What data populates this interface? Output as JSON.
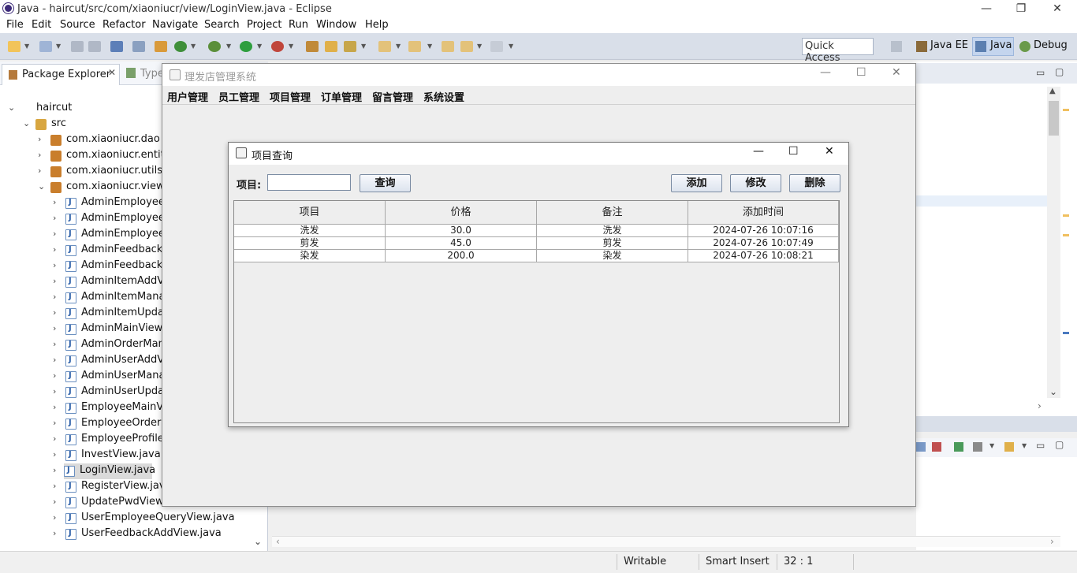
{
  "eclipse": {
    "title": "Java - haircut/src/com/xiaoniucr/view/LoginView.java - Eclipse",
    "menu": [
      "File",
      "Edit",
      "Source",
      "Refactor",
      "Navigate",
      "Search",
      "Project",
      "Run",
      "Window",
      "Help"
    ],
    "quick_access": "Quick Access",
    "perspectives": [
      "Java EE",
      "Java",
      "Debug"
    ],
    "window_controls": {
      "minimize": "—",
      "restore": "❐",
      "close": "✕"
    }
  },
  "package_explorer": {
    "tab_label": "Package Explorer",
    "tab2_label": "Type",
    "tree": [
      {
        "label": "haircut",
        "kind": "project",
        "depth": 0,
        "arrow": "⌄"
      },
      {
        "label": "src",
        "kind": "src",
        "depth": 1,
        "arrow": "⌄"
      },
      {
        "label": "com.xiaoniucr.dao",
        "kind": "pkg",
        "depth": 2,
        "arrow": "›"
      },
      {
        "label": "com.xiaoniucr.entity",
        "kind": "pkg",
        "depth": 2,
        "arrow": "›"
      },
      {
        "label": "com.xiaoniucr.utils",
        "kind": "pkg",
        "depth": 2,
        "arrow": "›"
      },
      {
        "label": "com.xiaoniucr.view",
        "kind": "pkg",
        "depth": 2,
        "arrow": "⌄"
      },
      {
        "label": "AdminEmployeeA",
        "kind": "java",
        "depth": 3,
        "arrow": "›"
      },
      {
        "label": "AdminEmployeeM",
        "kind": "java",
        "depth": 3,
        "arrow": "›"
      },
      {
        "label": "AdminEmployeeU",
        "kind": "java",
        "depth": 3,
        "arrow": "›"
      },
      {
        "label": "AdminFeedbackM",
        "kind": "java",
        "depth": 3,
        "arrow": "›"
      },
      {
        "label": "AdminFeedbackR",
        "kind": "java",
        "depth": 3,
        "arrow": "›"
      },
      {
        "label": "AdminItemAddVi",
        "kind": "java",
        "depth": 3,
        "arrow": "›"
      },
      {
        "label": "AdminItemManag",
        "kind": "java",
        "depth": 3,
        "arrow": "›"
      },
      {
        "label": "AdminItemUpdat",
        "kind": "java",
        "depth": 3,
        "arrow": "›"
      },
      {
        "label": "AdminMainView.j",
        "kind": "java",
        "depth": 3,
        "arrow": "›"
      },
      {
        "label": "AdminOrderMana",
        "kind": "java",
        "depth": 3,
        "arrow": "›"
      },
      {
        "label": "AdminUserAddVi",
        "kind": "java",
        "depth": 3,
        "arrow": "›"
      },
      {
        "label": "AdminUserManag",
        "kind": "java",
        "depth": 3,
        "arrow": "›"
      },
      {
        "label": "AdminUserUpdat",
        "kind": "java",
        "depth": 3,
        "arrow": "›"
      },
      {
        "label": "EmployeeMainVie",
        "kind": "java",
        "depth": 3,
        "arrow": "›"
      },
      {
        "label": "EmployeeOrderM",
        "kind": "java",
        "depth": 3,
        "arrow": "›"
      },
      {
        "label": "EmployeeProfileV",
        "kind": "java",
        "depth": 3,
        "arrow": "›"
      },
      {
        "label": "InvestView.java",
        "kind": "java",
        "depth": 3,
        "arrow": "›"
      },
      {
        "label": "LoginView.java",
        "kind": "java",
        "depth": 3,
        "arrow": "›",
        "selected": true
      },
      {
        "label": "RegisterView.java",
        "kind": "java",
        "depth": 3,
        "arrow": "›"
      },
      {
        "label": "UpdatePwdView.java",
        "kind": "java",
        "depth": 3,
        "arrow": "›"
      },
      {
        "label": "UserEmployeeQueryView.java",
        "kind": "java",
        "depth": 3,
        "arrow": "›"
      },
      {
        "label": "UserFeedbackAddView.java",
        "kind": "java",
        "depth": 3,
        "arrow": "›"
      }
    ]
  },
  "statusbar": {
    "mode": "Writable",
    "insert": "Smart Insert",
    "position": "32 : 1"
  },
  "app": {
    "title": "理发店管理系统",
    "menu": [
      "用户管理",
      "员工管理",
      "项目管理",
      "订单管理",
      "留言管理",
      "系统设置"
    ],
    "window_controls": {
      "minimize": "—",
      "maximize": "☐",
      "close": "✕"
    }
  },
  "dialog": {
    "title": "项目查询",
    "item_label": "项目:",
    "item_value": "",
    "query_button": "查询",
    "add_button": "添加",
    "edit_button": "修改",
    "delete_button": "删除",
    "window_controls": {
      "minimize": "—",
      "maximize": "☐",
      "close": "✕"
    },
    "table": {
      "columns": [
        "项目",
        "价格",
        "备注",
        "添加时间"
      ],
      "rows": [
        [
          "洗发",
          "30.0",
          "洗发",
          "2024-07-26 10:07:16"
        ],
        [
          "剪发",
          "45.0",
          "剪发",
          "2024-07-26 10:07:49"
        ],
        [
          "染发",
          "200.0",
          "染发",
          "2024-07-26 10:08:21"
        ]
      ]
    }
  }
}
